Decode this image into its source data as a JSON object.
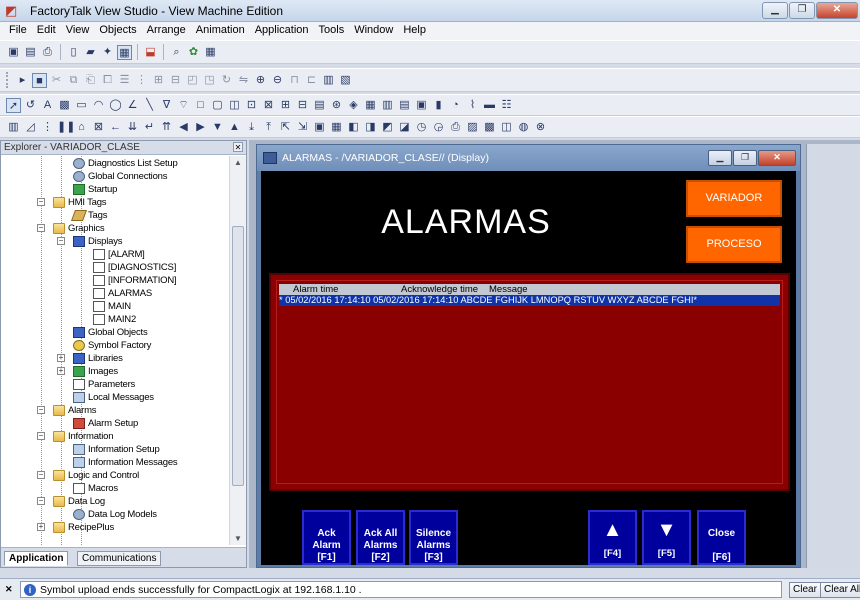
{
  "app": {
    "title": "FactoryTalk View Studio - View Machine Edition",
    "window_buttons": [
      "minimize",
      "maximize",
      "close"
    ]
  },
  "menu": [
    "File",
    "Edit",
    "View",
    "Objects",
    "Arrange",
    "Animation",
    "Application",
    "Tools",
    "Window",
    "Help"
  ],
  "explorer": {
    "title": "Explorer - VARIADOR_CLASE",
    "tabs": [
      "Application",
      "Communications"
    ],
    "items": [
      {
        "label": "Diagnostics List Setup",
        "icon": "gear"
      },
      {
        "label": "Global Connections",
        "icon": "gear"
      },
      {
        "label": "Startup",
        "icon": "green"
      },
      {
        "label": "HMI Tags",
        "icon": "folder"
      },
      {
        "label": "Tags",
        "icon": "tag"
      },
      {
        "label": "Graphics",
        "icon": "folder"
      },
      {
        "label": "Displays",
        "icon": "blue"
      },
      {
        "label": "[ALARM]",
        "icon": "doc"
      },
      {
        "label": "[DIAGNOSTICS]",
        "icon": "doc"
      },
      {
        "label": "[INFORMATION]",
        "icon": "doc"
      },
      {
        "label": "ALARMAS",
        "icon": "doc"
      },
      {
        "label": "MAIN",
        "icon": "doc"
      },
      {
        "label": "MAIN2",
        "icon": "doc"
      },
      {
        "label": "Global Objects",
        "icon": "blue"
      },
      {
        "label": "Symbol Factory",
        "icon": "sym"
      },
      {
        "label": "Libraries",
        "icon": "blue"
      },
      {
        "label": "Images",
        "icon": "green"
      },
      {
        "label": "Parameters",
        "icon": "doc"
      },
      {
        "label": "Local Messages",
        "icon": "lib"
      },
      {
        "label": "Alarms",
        "icon": "folder"
      },
      {
        "label": "Alarm Setup",
        "icon": "red"
      },
      {
        "label": "Information",
        "icon": "folder"
      },
      {
        "label": "Information Setup",
        "icon": "lib"
      },
      {
        "label": "Information Messages",
        "icon": "lib"
      },
      {
        "label": "Logic and Control",
        "icon": "folder"
      },
      {
        "label": "Macros",
        "icon": "doc"
      },
      {
        "label": "Data Log",
        "icon": "folder"
      },
      {
        "label": "Data Log Models",
        "icon": "gear"
      },
      {
        "label": "RecipePlus",
        "icon": "folder"
      }
    ]
  },
  "display": {
    "window_title": "ALARMAS - /VARIADOR_CLASE// (Display)",
    "heading": "ALARMAS",
    "nav_buttons": [
      "VARIADOR",
      "PROCESO"
    ],
    "alarm_table": {
      "columns": [
        "Alarm time",
        "Acknowledge time",
        "Message"
      ],
      "rows": [
        {
          "text": "* 05/02/2016 17:14:10  05/02/2016 17:14:10  ABCDE FGHIJK LMNOPQ RSTUV WXYZ ABCDE FGHI*"
        }
      ]
    },
    "buttons": [
      {
        "lines": [
          "Ack",
          "Alarm",
          "[F1]"
        ]
      },
      {
        "lines": [
          "Ack All",
          "Alarms",
          "[F2]"
        ]
      },
      {
        "lines": [
          "Silence",
          "Alarms",
          "[F3]"
        ]
      },
      {
        "glyph": "▲",
        "key": "[F4]"
      },
      {
        "glyph": "▼",
        "key": "[F5]"
      },
      {
        "lines": [
          "Close",
          "",
          "[F6]"
        ]
      }
    ]
  },
  "status": {
    "message": "Symbol upload ends successfully for CompactLogix at 192.168.1.10 .",
    "buttons": [
      "Clear",
      "Clear All"
    ]
  },
  "colors": {
    "hmi_background": "#000000",
    "nav_button": "#ff6600",
    "alarm_panel": "#8b0000",
    "alarm_row_selected": "#1033a8",
    "hmi_button": "#00009c"
  }
}
